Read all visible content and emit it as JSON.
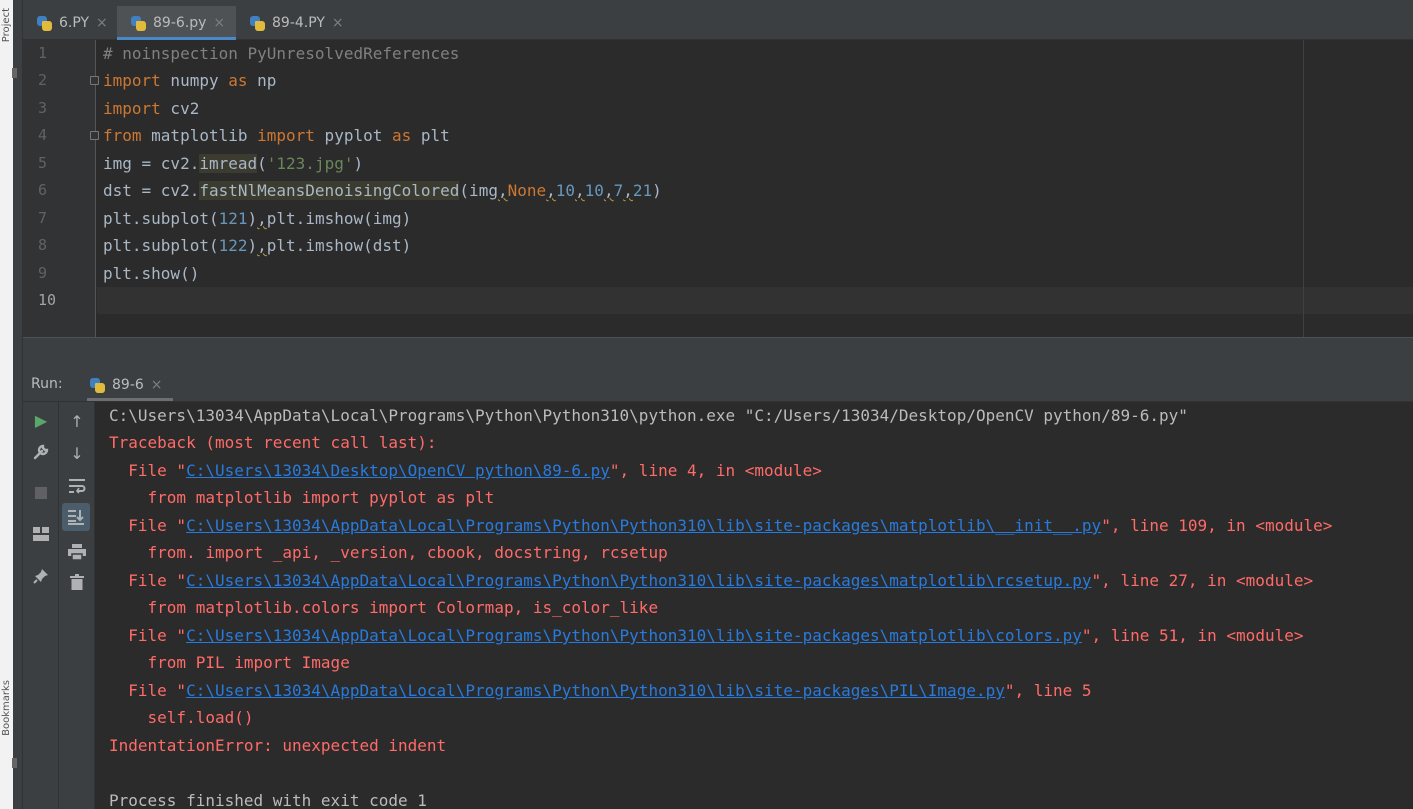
{
  "sidebar": {
    "project_label": "Project",
    "bookmarks_label": "Bookmarks"
  },
  "tabs": [
    {
      "label": "6.PY",
      "active": false
    },
    {
      "label": "89-6.py",
      "active": true
    },
    {
      "label": "89-4.PY",
      "active": false
    }
  ],
  "close_glyph": "×",
  "editor": {
    "line_numbers": [
      "1",
      "2",
      "3",
      "4",
      "5",
      "6",
      "7",
      "8",
      "9",
      "10"
    ],
    "current_line": 10,
    "code": {
      "l1": "# noinspection PyUnresolvedReferences",
      "l2": {
        "kw1": "import",
        "mod": " numpy ",
        "kw2": "as",
        "alias": " np"
      },
      "l3": {
        "kw1": "import",
        "mod": " cv2"
      },
      "l4": {
        "kw1": "from",
        "mod": " matplotlib ",
        "kw2": "import",
        "sub": " pyplot ",
        "kw3": "as",
        "alias": " plt"
      },
      "l5": {
        "pre": "img = cv2.",
        "fn": "imread",
        "open": "(",
        "str": "'123.jpg'",
        "close": ")"
      },
      "l6": {
        "pre": "dst = cv2.",
        "fn": "fastNlMeansDenoisingColored",
        "open": "(img",
        "c1": ",",
        "none": "None",
        "c2": ",",
        "n1": "10",
        "c3": ",",
        "n2": "10",
        "c4": ",",
        "n3": "7",
        "c5": ",",
        "n4": "21",
        "close": ")"
      },
      "l7": {
        "pre": "plt.subplot(",
        "num": "121",
        "mid": ")",
        "comma": ",",
        "post": "plt.imshow(img)"
      },
      "l8": {
        "pre": "plt.subplot(",
        "num": "122",
        "mid": ")",
        "comma": ",",
        "post": "plt.imshow(dst)"
      },
      "l9": "plt.show()"
    }
  },
  "run": {
    "label": "Run:",
    "tab_label": "89-6",
    "tools_left": [
      "play-icon",
      "wrench-icon",
      "stop-icon",
      "layout-icon",
      "pin-icon"
    ],
    "tools_right": [
      "arrow-up-icon",
      "arrow-down-icon",
      "soft-wrap-icon",
      "scroll-to-end-icon",
      "print-icon",
      "trash-icon"
    ],
    "console": {
      "cmd": "C:\\Users\\13034\\AppData\\Local\\Programs\\Python\\Python310\\python.exe \"C:/Users/13034/Desktop/OpenCV python/89-6.py\"",
      "traceback": "Traceback (most recent call last):",
      "file_prefix": "  File \"",
      "frames": [
        {
          "path": "C:\\Users\\13034\\Desktop\\OpenCV python\\89-6.py",
          "rest": "\", line 4, in <module>",
          "code": "    from matplotlib import pyplot as plt"
        },
        {
          "path": "C:\\Users\\13034\\AppData\\Local\\Programs\\Python\\Python310\\lib\\site-packages\\matplotlib\\__init__.py",
          "rest": "\", line 109, in <module>",
          "code": "    from. import _api, _version, cbook, docstring, rcsetup"
        },
        {
          "path": "C:\\Users\\13034\\AppData\\Local\\Programs\\Python\\Python310\\lib\\site-packages\\matplotlib\\rcsetup.py",
          "rest": "\", line 27, in <module>",
          "code": "    from matplotlib.colors import Colormap, is_color_like"
        },
        {
          "path": "C:\\Users\\13034\\AppData\\Local\\Programs\\Python\\Python310\\lib\\site-packages\\matplotlib\\colors.py",
          "rest": "\", line 51, in <module>",
          "code": "    from PIL import Image"
        },
        {
          "path": "C:\\Users\\13034\\AppData\\Local\\Programs\\Python\\Python310\\lib\\site-packages\\PIL\\Image.py",
          "rest": "\", line 5",
          "code": "    self.load()"
        }
      ],
      "error": "IndentationError: unexpected indent",
      "exit": "Process finished with exit code 1"
    }
  }
}
